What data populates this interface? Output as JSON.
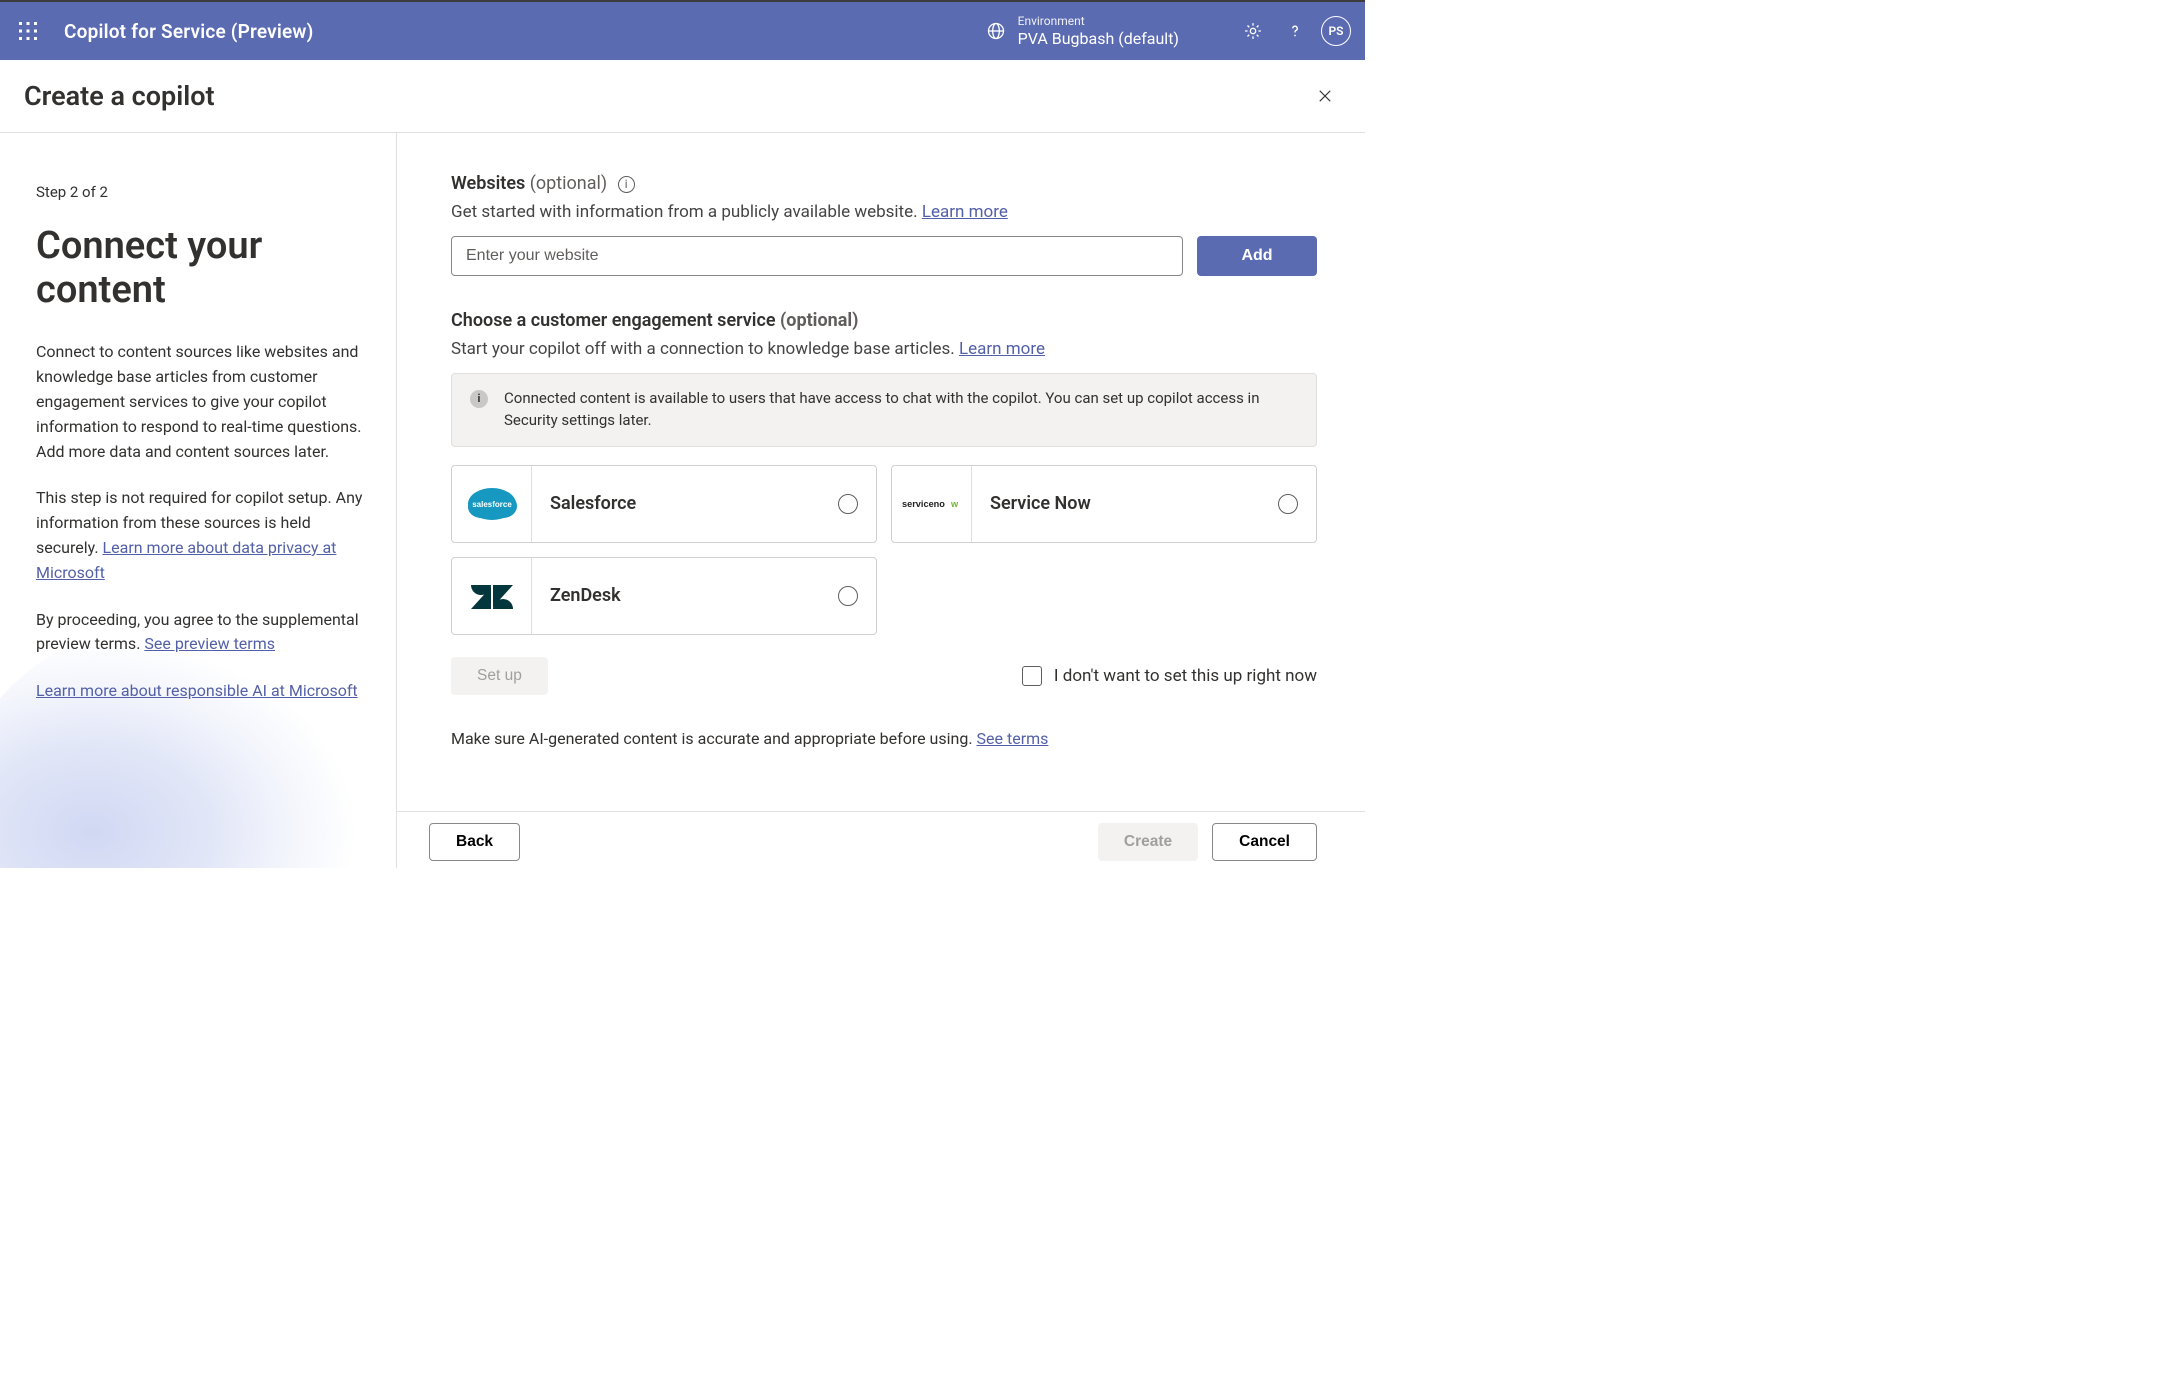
{
  "topbar": {
    "app_title": "Copilot for Service (Preview)",
    "env_label": "Environment",
    "env_name": "PVA Bugbash (default)",
    "avatar_initials": "PS"
  },
  "dialog": {
    "title": "Create a copilot"
  },
  "left": {
    "step": "Step 2 of 2",
    "heading": "Connect your content",
    "para1": "Connect to content sources like websites and knowledge base articles from customer engagement services to give your copilot information to respond to real-time questions. Add more data and content sources later.",
    "para2_pre": "This step is not required for copilot setup. Any information from these sources is held securely. ",
    "para2_link": "Learn more about data privacy at Microsoft",
    "para3_pre": "By proceeding, you agree to the supplemental preview terms. ",
    "para3_link": "See preview terms",
    "para4_link": "Learn more about responsible AI at Microsoft"
  },
  "right": {
    "websites": {
      "label_bold": "Websites",
      "label_optional": " (optional)",
      "desc_pre": "Get started with information from a publicly available website. ",
      "desc_link": "Learn more",
      "input_placeholder": "Enter your website",
      "add_label": "Add"
    },
    "ces": {
      "label_bold": "Choose a customer engagement service",
      "label_optional": " (optional)",
      "desc_pre": "Start your copilot off with a connection to knowledge base articles. ",
      "desc_link": "Learn more",
      "banner": "Connected content is available to users that have access to chat with the copilot. You can set up copilot access in Security settings later.",
      "options": [
        {
          "name": "Salesforce"
        },
        {
          "name": "Service Now"
        },
        {
          "name": "ZenDesk"
        }
      ],
      "setup_label": "Set up",
      "skip_label": "I don't want to set this up right now"
    },
    "footnote_pre": "Make sure AI-generated content is accurate and appropriate before using. ",
    "footnote_link": "See terms"
  },
  "footer": {
    "back": "Back",
    "create": "Create",
    "cancel": "Cancel"
  }
}
